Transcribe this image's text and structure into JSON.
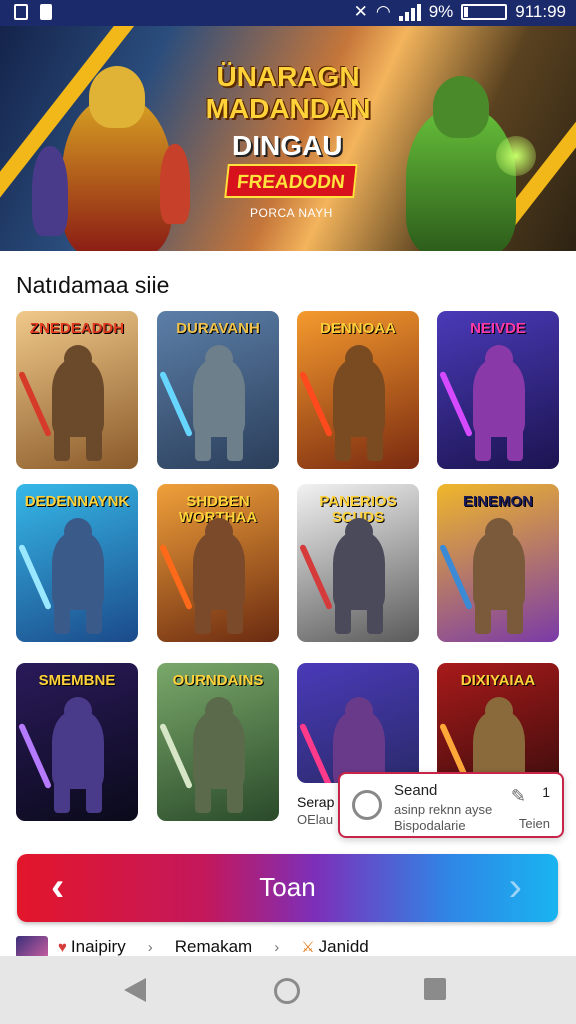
{
  "status_bar": {
    "battery": "9%",
    "time": "911:99"
  },
  "hero": {
    "title_line1": "ÜNARAGN",
    "title_line2": "MADANDAN",
    "title_line3": "DINGAU",
    "cta_label": "FREADODN",
    "subtitle": "PORCA NAYH"
  },
  "section_title": "Natıdamaa siie",
  "games": [
    {
      "title": "ZNEDEADDH",
      "title_color": "#e23b1f",
      "bg": [
        "#f0c98a",
        "#8a5a2a"
      ],
      "armor": "#6a4a2a",
      "accent": "#d63b2a"
    },
    {
      "title": "DURAVANH",
      "title_color": "#f1c34a",
      "bg": [
        "#5c7fa8",
        "#2b3e5a"
      ],
      "armor": "#6d7f8a",
      "accent": "#66d6ff"
    },
    {
      "title": "DENNOAA",
      "title_color": "#ffcf3a",
      "bg": [
        "#f59a2e",
        "#7a2a10"
      ],
      "armor": "#7a4a20",
      "accent": "#ff4a1e"
    },
    {
      "title": "NEIVDE",
      "title_color": "#ff3aa8",
      "bg": [
        "#4a3ab8",
        "#1b1450"
      ],
      "armor": "#8a3aa8",
      "accent": "#d64aff"
    },
    {
      "title": "DEDENNAYNK",
      "title_color": "#ffd23a",
      "bg": [
        "#36b8e8",
        "#1b4a8a"
      ],
      "armor": "#3a5a8a",
      "accent": "#9ae8ff"
    },
    {
      "title": "SHDBEN WORTHAA",
      "title_color": "#ffd23a",
      "bg": [
        "#f0a03a",
        "#6a2a10"
      ],
      "armor": "#7a4a2a",
      "accent": "#ff6a1a"
    },
    {
      "title": "PANERIOS SCUDS",
      "title_color": "#ffd23a",
      "bg": [
        "#f2f2f2",
        "#5a5a5a"
      ],
      "armor": "#4a4a5a",
      "accent": "#d63b3b"
    },
    {
      "title": "EINEMON",
      "title_color": "#1b1b5a",
      "bg": [
        "#f0b72a",
        "#7a3aa8"
      ],
      "armor": "#7a5a3a",
      "accent": "#3a8ad6"
    },
    {
      "title": "SMEMBNE",
      "title_color": "#ffd23a",
      "bg": [
        "#2a1a5a",
        "#0a0a1a"
      ],
      "armor": "#4a3a8a",
      "accent": "#b67aff"
    },
    {
      "title": "OURNDAINS",
      "title_color": "#ffd23a",
      "bg": [
        "#7aa86a",
        "#2a4a2a"
      ],
      "armor": "#5a6a4a",
      "accent": "#d6e6c6"
    },
    {
      "title": "",
      "title_color": "#ffffff",
      "bg": [
        "#4a3ab8",
        "#2a2a6a"
      ],
      "armor": "#6a3a8a",
      "accent": "#ff3a8a"
    },
    {
      "title": "DIXIYAIAA",
      "title_color": "#ffd23a",
      "bg": [
        "#a81a1a",
        "#2a0a0a"
      ],
      "armor": "#8a6a3a",
      "accent": "#ffa83a"
    }
  ],
  "popup": {
    "title": "Seand",
    "line1": "asinp reknn ayse",
    "line2": "Bispodalarie",
    "count": "1",
    "action": "Teien"
  },
  "behind_popup": {
    "line1": "Serap",
    "line2": "OElau"
  },
  "nav_bar": {
    "prev_glyph": "‹",
    "next_glyph": "›",
    "label": "Toan"
  },
  "breadcrumbs": {
    "item1": "Inaipiry",
    "item2": "Remakam",
    "item3": "Janidd",
    "separator": "›"
  }
}
